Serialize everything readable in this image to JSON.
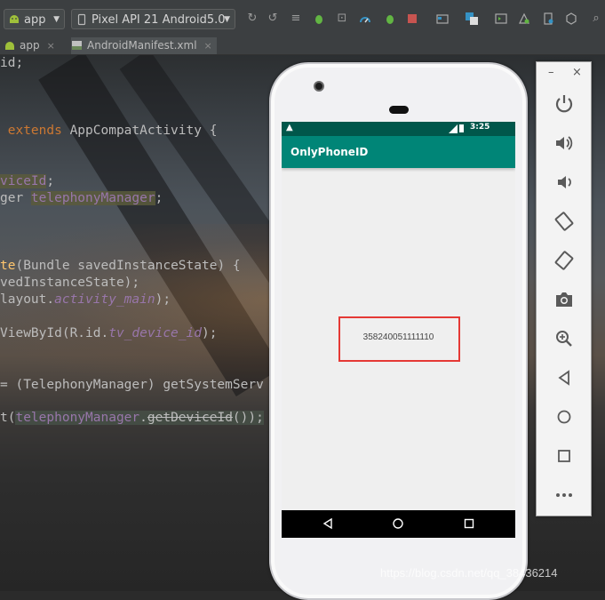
{
  "toolbar": {
    "module_label": "app",
    "device_label": "Pixel API 21 Android5.0"
  },
  "tabs": [
    {
      "label": "app"
    },
    {
      "label": "AndroidManifest.xml"
    }
  ],
  "code": {
    "l1": "id;",
    "l2_kw": "extends",
    "l2_rest": " AppCompatActivity {",
    "l3_fld": "viceId",
    "l3_rest": ";",
    "l4_pre": "ger ",
    "l4_fld": "telephonyManager",
    "l4_rest": ";",
    "l5_fn": "te",
    "l5_rest": "(Bundle savedInstanceState) {",
    "l6": "vedInstanceState);",
    "l7_pre": "layout.",
    "l7_it": "activity_main",
    "l7_rest": ");",
    "l8_pre": "ViewById(R.id.",
    "l8_it": "tv_device_id",
    "l8_rest": ");",
    "l9": "= (TelephonyManager) getSystemServ",
    "l10_pre": "t(",
    "l10_fld": "telephonyManager",
    "l10_dot": ".",
    "l10_strike": "getDeviceId",
    "l10_rest": "());"
  },
  "phone": {
    "status_time": "3:25",
    "app_title": "OnlyPhoneID",
    "device_id": "358240051111110"
  },
  "panel": {
    "minimize": "–",
    "close": "×"
  },
  "watermark": "https://blog.csdn.net/qq_38436214"
}
